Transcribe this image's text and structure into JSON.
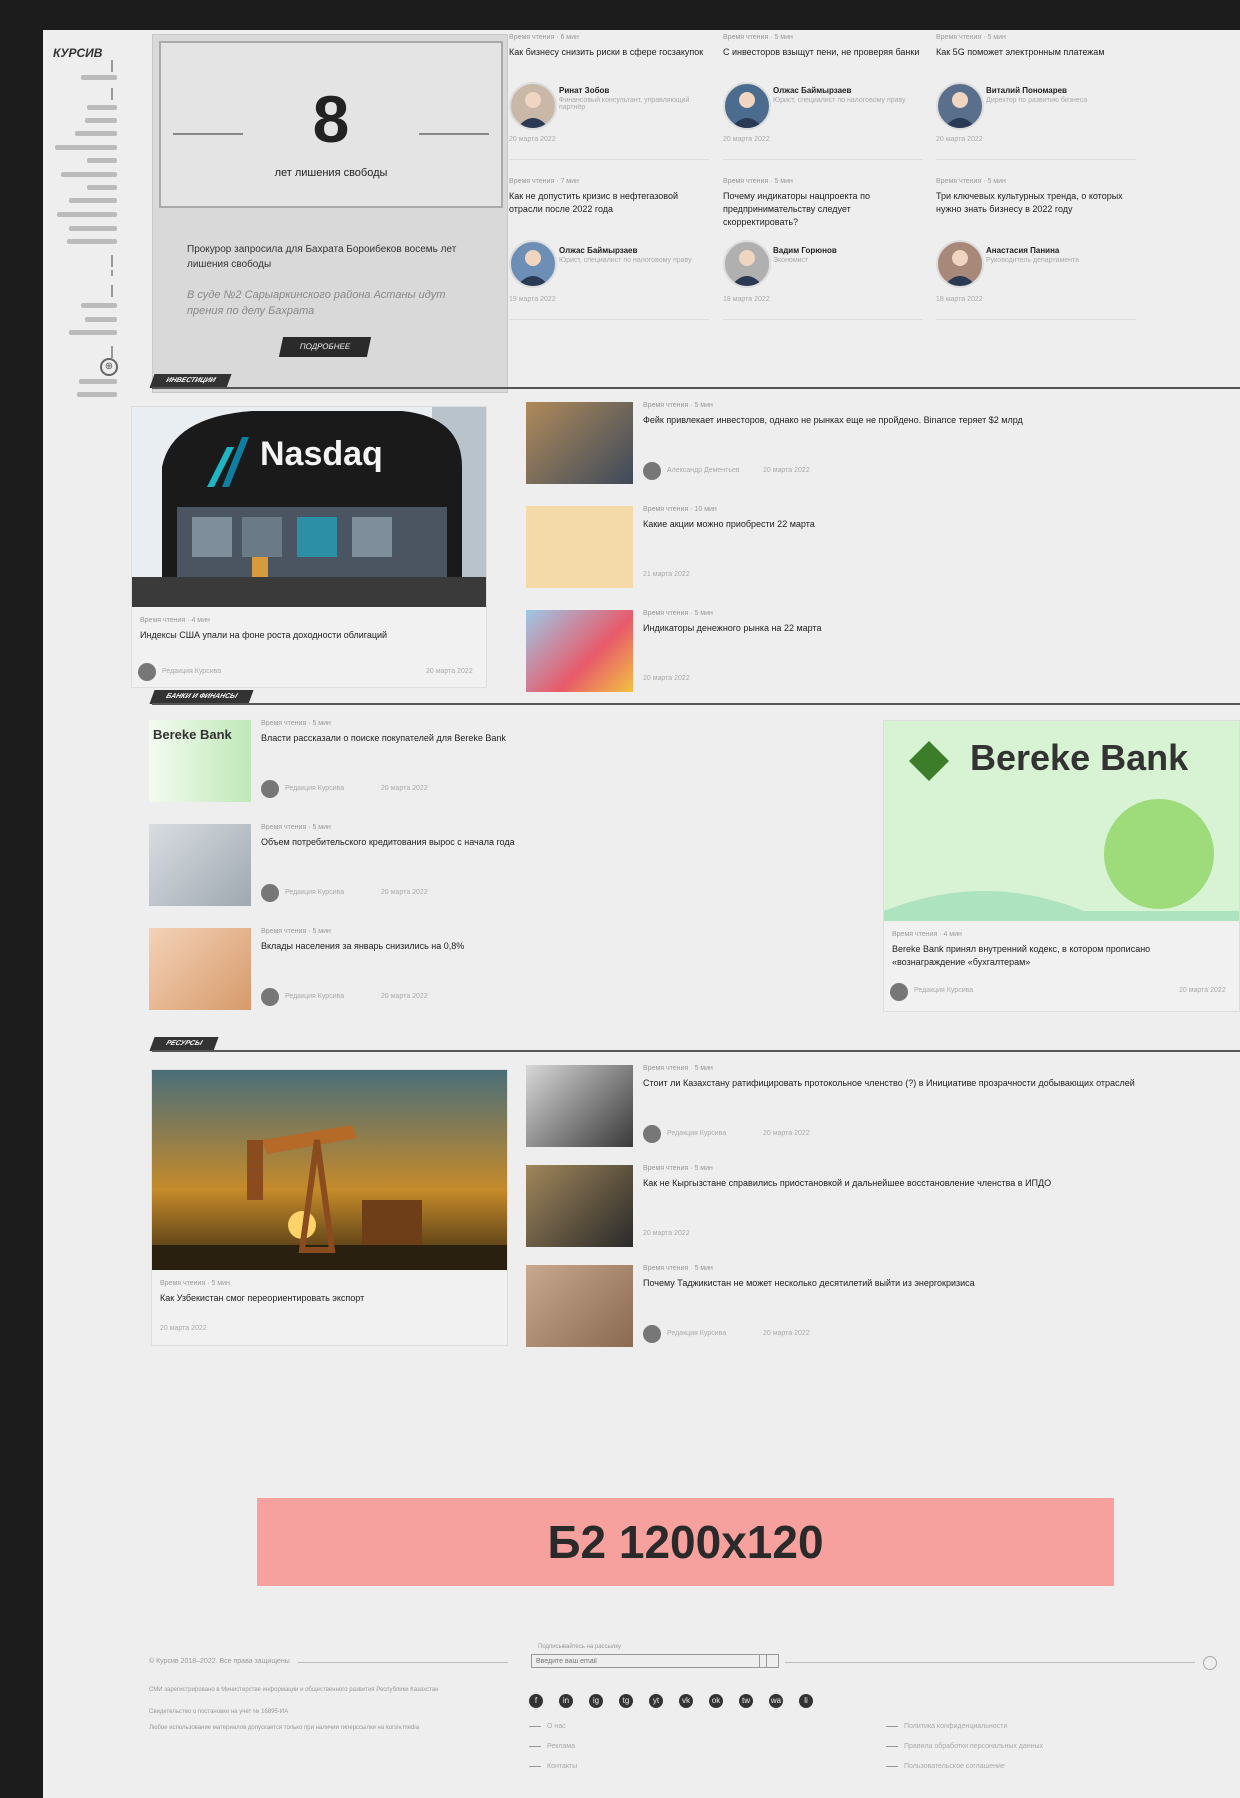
{
  "sidebar": {
    "title": "КУРСИВ"
  },
  "promo": {
    "number": "8",
    "subtitle": "лет лишения свободы",
    "text": "Прокурор запросила для Бахрата Бороибеков восемь лет лишения свободы",
    "quote": "В суде №2 Сарыаркинского района Астаны идут прения по делу Бахрата",
    "button": "ПОДРОБНЕЕ"
  },
  "top_cards": [
    {
      "meta": "Время чтения · 6 мин",
      "title": "Как бизнесу снизить риски в сфере госзакупок",
      "author": "Ринат Зобов",
      "role": "Финансовый консультант, управляющий партнёр",
      "date": "20 марта 2022"
    },
    {
      "meta": "Время чтения · 5 мин",
      "title": "С инвесторов взыщут пени, не проверяя банки",
      "author": "Олжас Баймырзаев",
      "role": "Юрист, специалист по налоговому праву",
      "date": "20 марта 2022"
    },
    {
      "meta": "Время чтения · 5 мин",
      "title": "Как 5G поможет электронным платежам",
      "author": "Виталий Пономарев",
      "role": "Директор по развитию бизнеса",
      "date": "20 марта 2022"
    },
    {
      "meta": "Время чтения · 7 мин",
      "title": "Как не допустить кризис в нефтегазовой отрасли после 2022 года",
      "author": "Олжас Баймырзаев",
      "role": "Юрист, специалист по налоговому праву",
      "date": "19 марта 2022"
    },
    {
      "meta": "Время чтения · 5 мин",
      "title": "Почему индикаторы нацпроекта по предпринимательству следует скорректировать?",
      "author": "Вадим Горюнов",
      "role": "Экономист",
      "date": "18 марта 2022"
    },
    {
      "meta": "Время чтения · 5 мин",
      "title": "Три ключевых культурных тренда, о которых нужно знать бизнесу в 2022 году",
      "author": "Анастасия Панина",
      "role": "Руководитель департамента",
      "date": "18 марта 2022"
    }
  ],
  "sections": {
    "investments": "ИНВЕСТИЦИИ",
    "banks": "БАНКИ И ФИНАНСЫ",
    "resources": "РЕСУРСЫ"
  },
  "inv": {
    "main": {
      "meta": "Время чтения · 4 мин",
      "title": "Индексы США упали на фоне роста доходности облигаций",
      "author": "Редакция Курсива",
      "date": "20 марта 2022",
      "logo": "Nasdaq"
    },
    "items": [
      {
        "meta": "Время чтения · 5 мин",
        "title": "Фейк привлекает инвесторов, однако не рынках еще не пройдено. Binance теряет $2 млрд",
        "author": "Александр Дементьев",
        "date": "20 марта 2022"
      },
      {
        "meta": "Время чтения · 10 мин",
        "title": "Какие акции можно приобрести 22 марта",
        "date": "21 марта 2022"
      },
      {
        "meta": "Время чтения · 5 мин",
        "title": "Индикаторы денежного рынка на 22 марта",
        "date": "20 марта 2022"
      }
    ]
  },
  "banks": {
    "items": [
      {
        "meta": "Время чтения · 5 мин",
        "title": "Власти рассказали о поиске покупателей для Bereke Bank",
        "author": "Редакция Курсива",
        "date": "20 марта 2022",
        "thumb_text": "Bereke Bank"
      },
      {
        "meta": "Время чтения · 5 мин",
        "title": "Объем потребительского кредитования вырос с начала года",
        "author": "Редакция Курсива",
        "date": "20 марта 2022"
      },
      {
        "meta": "Время чтения · 5 мин",
        "title": "Вклады населения за январь снизились на 0,8%",
        "author": "Редакция Курсива",
        "date": "20 марта 2022"
      }
    ],
    "feature": {
      "logo": "Bereke Bank",
      "meta": "Время чтения · 4 мин",
      "title": "Bereke Bank принял внутренний кодекс, в котором прописано «вознаграждение «бухгалтерам»",
      "author": "Редакция Курсива",
      "date": "20 марта 2022"
    }
  },
  "res": {
    "main": {
      "meta": "Время чтения · 5 мин",
      "title": "Как Узбекистан смог переориентировать экспорт",
      "date": "20 марта 2022"
    },
    "items": [
      {
        "meta": "Время чтения · 5 мин",
        "title": "Стоит ли Казахстану ратифицировать протокольное членство (?) в Инициативе прозрачности добывающих отраслей",
        "author": "Редакция Курсива",
        "date": "20 марта 2022"
      },
      {
        "meta": "Время чтения · 5 мин",
        "title": "Как не Кыргызстане справились приостановкой и дальнейшее восстановление членства в ИПДО",
        "date": "20 марта 2022"
      },
      {
        "meta": "Время чтения · 5 мин",
        "title": "Почему Таджикистан не может несколько десятилетий выйти из энергокризиса",
        "author": "Редакция Курсива",
        "date": "20 марта 2022"
      }
    ]
  },
  "ad": {
    "label": "Б2 1200x120"
  },
  "footer": {
    "copyright": "© Курсив 2018–2022. Все права защищены",
    "subscribe_label": "Подписывайтесь на рассылку",
    "subscribe_placeholder": "Введите ваш email",
    "legal_1": "СМИ зарегистрировано в Министерстве информации и общественного развития Республики Казахстан",
    "legal_2": "Свидетельство о постановке на учет № 16895-ИА",
    "legal_3": "Любое использование материалов допускается только при наличии гиперссылки на kursiv.media",
    "links_left": [
      "О нас",
      "Реклама",
      "Контакты"
    ],
    "links_right": [
      "Политика конфиденциальности",
      "Правила обработки персональных данных",
      "Пользовательское соглашение"
    ],
    "socials": [
      "f",
      "in",
      "ig",
      "tg",
      "yt",
      "vk",
      "ok",
      "tw",
      "wa",
      "li"
    ]
  }
}
